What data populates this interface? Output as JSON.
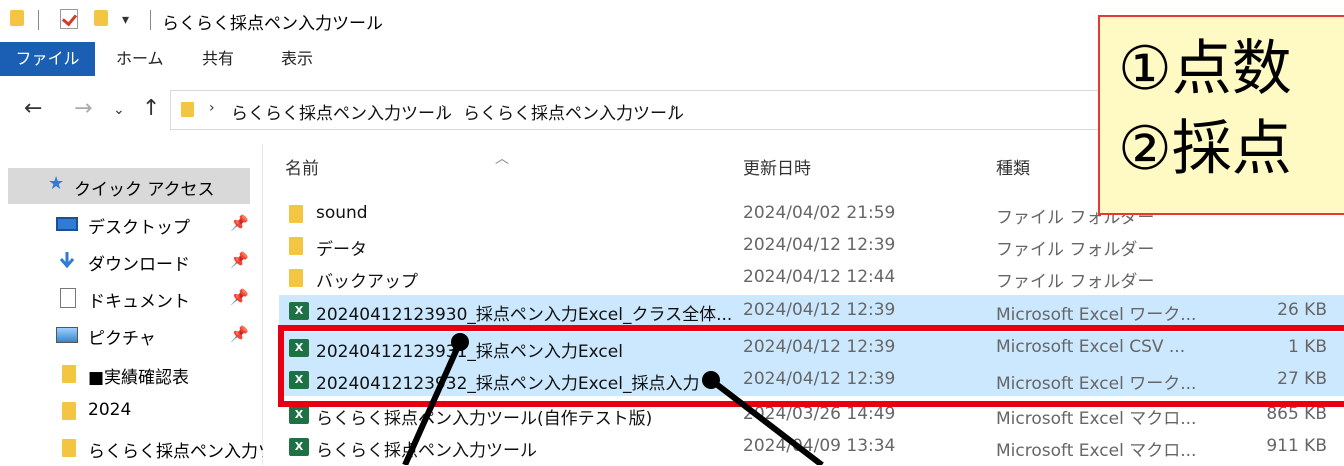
{
  "window": {
    "title": "らくらく採点ペン入力ツール"
  },
  "ribbon": {
    "tabs": [
      {
        "label": "ファイル",
        "active": true
      },
      {
        "label": "ホーム"
      },
      {
        "label": "共有"
      },
      {
        "label": "表示"
      }
    ]
  },
  "address": {
    "breadcrumbs": [
      "らくらく採点ペン入力ツール",
      "らくらく採点ペン入力ツール"
    ]
  },
  "nav": {
    "items": [
      {
        "label": "クイック アクセス",
        "icon": "star-icon",
        "selected": true
      },
      {
        "label": "デスクトップ",
        "icon": "desktop-icon",
        "pinned": true
      },
      {
        "label": "ダウンロード",
        "icon": "download-icon",
        "pinned": true
      },
      {
        "label": "ドキュメント",
        "icon": "document-icon",
        "pinned": true
      },
      {
        "label": "ピクチャ",
        "icon": "pictures-icon",
        "pinned": true
      },
      {
        "label": "■実績確認表",
        "icon": "folder-icon"
      },
      {
        "label": "2024",
        "icon": "folder-icon"
      },
      {
        "label": "らくらく採点ペン入力ツ",
        "icon": "folder-icon"
      }
    ]
  },
  "columns": {
    "name": "名前",
    "date": "更新日時",
    "type": "種類"
  },
  "files": [
    {
      "name": "sound",
      "date": "2024/04/02 21:59",
      "type": "ファイル フォルダー",
      "size": "",
      "icon": "folder-icon",
      "selected": false
    },
    {
      "name": "データ",
      "date": "2024/04/12 12:39",
      "type": "ファイル フォルダー",
      "size": "",
      "icon": "folder-icon",
      "selected": false
    },
    {
      "name": "バックアップ",
      "date": "2024/04/12 12:44",
      "type": "ファイル フォルダー",
      "size": "",
      "icon": "folder-icon",
      "selected": false
    },
    {
      "name": "20240412123930_採点ペン入力Excel_クラス全体...",
      "date": "2024/04/12 12:39",
      "type": "Microsoft Excel ワーク...",
      "size": "26 KB",
      "icon": "excel-icon",
      "selected": true
    },
    {
      "name": "20240412123931_採点ペン入力Excel",
      "date": "2024/04/12 12:39",
      "type": "Microsoft Excel CSV ...",
      "size": "1 KB",
      "icon": "excel-icon",
      "selected": true
    },
    {
      "name": "20240412123932_採点ペン入力Excel_採点入力",
      "date": "2024/04/12 12:39",
      "type": "Microsoft Excel ワーク...",
      "size": "27 KB",
      "icon": "excel-icon",
      "selected": true
    },
    {
      "name": "らくらく採点ペン入力ツール(自作テスト版)",
      "date": "2024/03/26 14:49",
      "type": "Microsoft Excel マクロ...",
      "size": "865 KB",
      "icon": "excel-macro-icon",
      "selected": false
    },
    {
      "name": "らくらく採点ペン入力ツール",
      "date": "2024/04/09 13:34",
      "type": "Microsoft Excel マクロ...",
      "size": "911 KB",
      "icon": "excel-macro-icon",
      "selected": false
    }
  ],
  "annotation": {
    "lines": [
      "①点数",
      "②採点"
    ],
    "colors": {
      "box": "#e60012",
      "callout_bg": "#fff9c4"
    }
  }
}
